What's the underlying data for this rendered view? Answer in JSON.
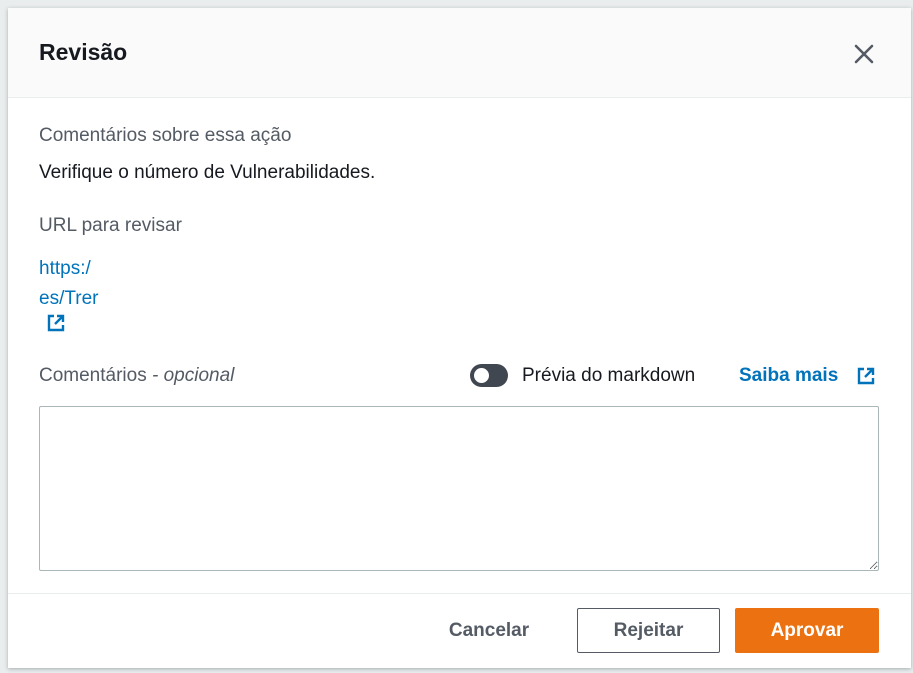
{
  "modal": {
    "title": "Revisão",
    "close_icon": "close-icon"
  },
  "comments_section": {
    "label": "Comentários sobre essa ação",
    "value": "Verifique o número de Vulnerabilidades."
  },
  "url_section": {
    "label": "URL para revisar",
    "url_line_1": "https:/",
    "url_line_2": "es/Trer",
    "external_icon": "external-link-icon"
  },
  "comments_input": {
    "label": "Comentários",
    "optional_suffix": " - opcional",
    "value": "",
    "placeholder": ""
  },
  "markdown_toggle": {
    "label": "Prévia do markdown",
    "enabled": false
  },
  "learn_more": {
    "label": "Saiba mais",
    "icon": "external-link-icon"
  },
  "footer": {
    "cancel_label": "Cancelar",
    "reject_label": "Rejeitar",
    "approve_label": "Aprovar"
  },
  "colors": {
    "accent": "#ec7211",
    "link": "#0073bb",
    "text": "#16191f",
    "muted": "#545b64"
  }
}
